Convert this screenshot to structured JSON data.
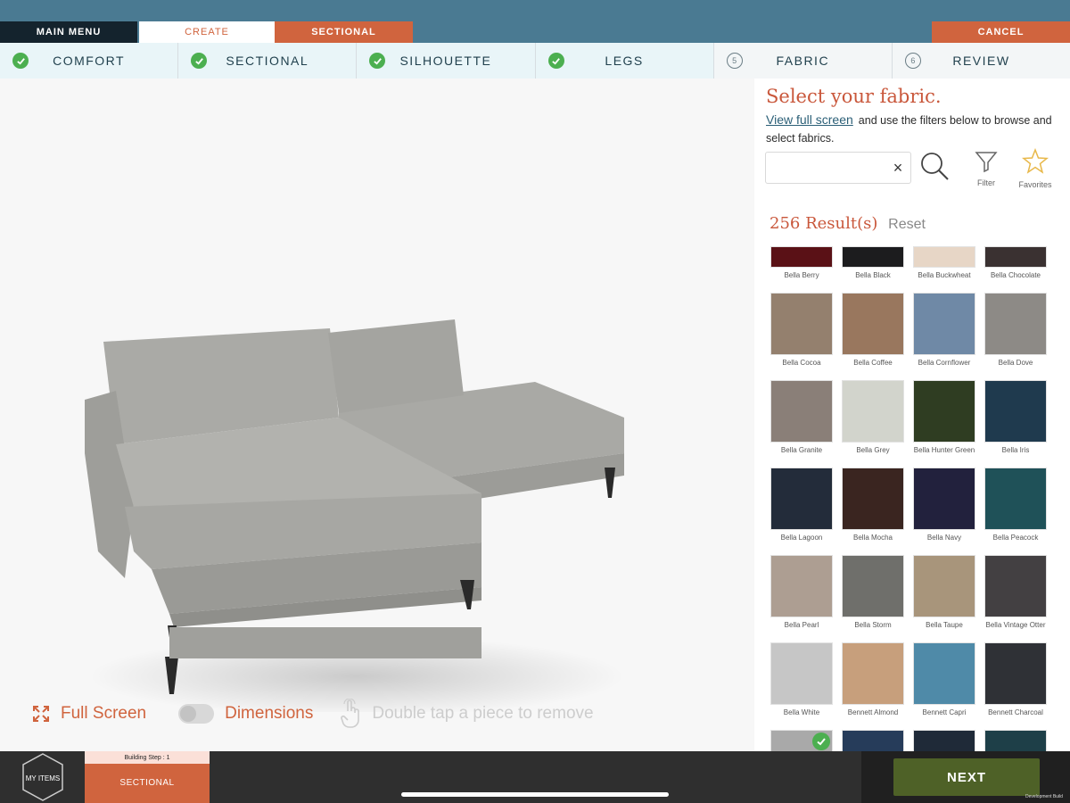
{
  "header": {
    "main_menu": "MAIN MENU",
    "create": "CREATE",
    "sectional": "SECTIONAL",
    "cancel": "CANCEL"
  },
  "steps": [
    {
      "label": "COMFORT",
      "status": "done"
    },
    {
      "label": "SECTIONAL",
      "status": "done"
    },
    {
      "label": "SILHOUETTE",
      "status": "done"
    },
    {
      "label": "LEGS",
      "status": "done"
    },
    {
      "label": "FABRIC",
      "status": "pending",
      "number": "5"
    },
    {
      "label": "REVIEW",
      "status": "pending",
      "number": "6"
    }
  ],
  "viewer": {
    "full_screen": "Full Screen",
    "dimensions": "Dimensions",
    "double_tap": "Double tap a piece to remove"
  },
  "panel": {
    "title": "Select your fabric.",
    "view_full": "View full screen",
    "desc_rest": "and use the filters below to browse and select fabrics.",
    "search_value": "",
    "search_placeholder": "",
    "filter_label": "Filter",
    "favorites_label": "Favorites",
    "results_count": "256",
    "results_word": "Result(s)",
    "reset": "Reset"
  },
  "swatches": [
    [
      {
        "name": "Bella Berry",
        "color": "#5a1116"
      },
      {
        "name": "Bella Black",
        "color": "#1c1c1e"
      },
      {
        "name": "Bella Buckwheat",
        "color": "#e7d6c6"
      },
      {
        "name": "Bella Chocolate",
        "color": "#3a3131"
      }
    ],
    [
      {
        "name": "Bella Cocoa",
        "color": "#94806e"
      },
      {
        "name": "Bella Coffee",
        "color": "#99775e"
      },
      {
        "name": "Bella Cornflower",
        "color": "#6f89a6"
      },
      {
        "name": "Bella Dove",
        "color": "#8d8a86"
      }
    ],
    [
      {
        "name": "Bella Granite",
        "color": "#8a7f78"
      },
      {
        "name": "Bella Grey",
        "color": "#d2d4cc"
      },
      {
        "name": "Bella Hunter Green",
        "color": "#2f3d22"
      },
      {
        "name": "Bella Iris",
        "color": "#1f3a4e"
      }
    ],
    [
      {
        "name": "Bella Lagoon",
        "color": "#232c3a"
      },
      {
        "name": "Bella Mocha",
        "color": "#3a2520"
      },
      {
        "name": "Bella Navy",
        "color": "#22213d"
      },
      {
        "name": "Bella Peacock",
        "color": "#1f5158"
      }
    ],
    [
      {
        "name": "Bella Pearl",
        "color": "#ad9e92"
      },
      {
        "name": "Bella Storm",
        "color": "#6f6f6b"
      },
      {
        "name": "Bella Taupe",
        "color": "#a8957b"
      },
      {
        "name": "Bella Vintage Otter",
        "color": "#434042"
      }
    ],
    [
      {
        "name": "Bella White",
        "color": "#c6c6c6"
      },
      {
        "name": "Bennett Almond",
        "color": "#c79f7c"
      },
      {
        "name": "Bennett Capri",
        "color": "#4f8aa8"
      },
      {
        "name": "Bennett Charcoal",
        "color": "#2f3136"
      }
    ],
    [
      {
        "name": "",
        "color": "#a9a9a9",
        "selected": true
      },
      {
        "name": "",
        "color": "#263c5a"
      },
      {
        "name": "",
        "color": "#1f2a38"
      },
      {
        "name": "",
        "color": "#1e3f48"
      }
    ]
  ],
  "bottom": {
    "my_items": "MY ITEMS",
    "building_step": "Building Step : 1",
    "build_name": "SECTIONAL",
    "next": "NEXT",
    "dev_build": "Development Build"
  }
}
